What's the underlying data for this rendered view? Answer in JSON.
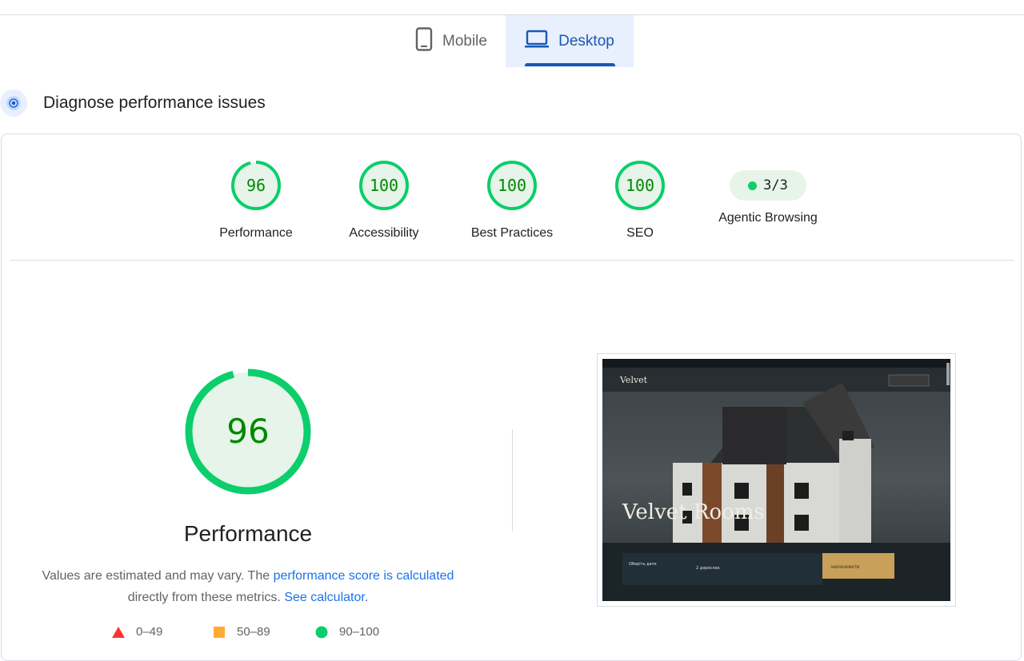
{
  "tabs": {
    "mobile_label": "Mobile",
    "desktop_label": "Desktop",
    "active": "Desktop"
  },
  "section": {
    "title": "Diagnose performance issues"
  },
  "gauges": [
    {
      "score": "96",
      "label": "Performance"
    },
    {
      "score": "100",
      "label": "Accessibility"
    },
    {
      "score": "100",
      "label": "Best Practices"
    },
    {
      "score": "100",
      "label": "SEO"
    }
  ],
  "agentic": {
    "value": "3/3",
    "label": "Agentic Browsing"
  },
  "performance": {
    "score": "96",
    "fraction": 0.96,
    "title": "Performance",
    "desc_prefix": "Values are estimated and may vary. The ",
    "desc_link1": "performance score is calculated",
    "desc_mid": " directly from these metrics. ",
    "desc_link2": "See calculator",
    "desc_suffix": "."
  },
  "legend": [
    {
      "range": "0–49",
      "shape": "triangle",
      "color": "#ff3333"
    },
    {
      "range": "50–89",
      "shape": "square",
      "color": "#ffaa33"
    },
    {
      "range": "90–100",
      "shape": "circle",
      "color": "#0cce6b"
    }
  ],
  "screenshot": {
    "brand": "Velvet",
    "hero_title": "Velvet Rooms",
    "booking_label": "Оберіть дате",
    "guests_label": "2 дорослих",
    "cta_label": "ЗАБРОНЮВАТИ"
  },
  "colors": {
    "pass": "#0cce6b",
    "pass_text": "#008800",
    "pass_bg": "#e6f4ea",
    "accent": "#1a57b5"
  }
}
